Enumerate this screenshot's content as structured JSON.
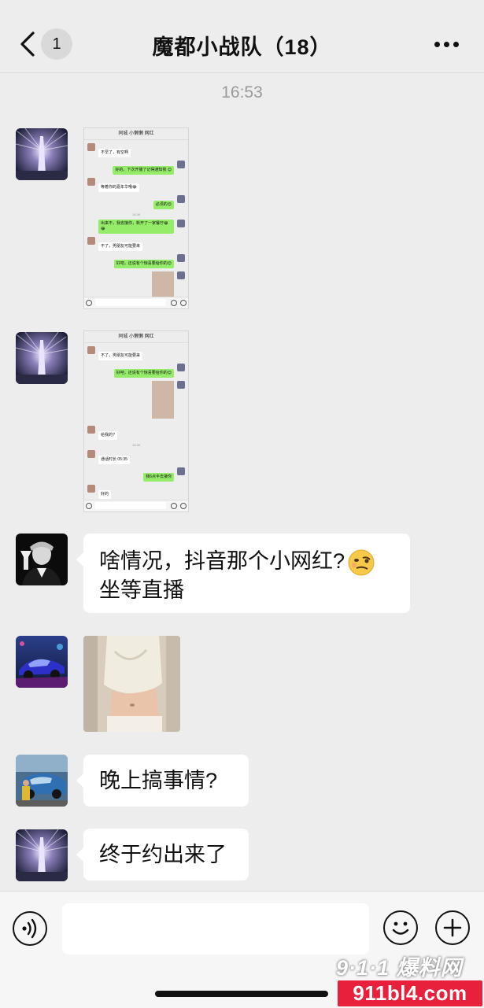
{
  "header": {
    "unread_count": "1",
    "title": "魔都小战队（18）",
    "back_icon": "chevron-left-icon",
    "more_icon": "more-dots-icon"
  },
  "chat": {
    "timestamp": "16:53",
    "screenshot1": {
      "title": "同城 小懒懒 网红",
      "messages": [
        {
          "side": "left",
          "text": "不早了，有空啊"
        },
        {
          "side": "right",
          "text": "好的，下次开播了记得通知我 😊"
        },
        {
          "side": "left",
          "text": "等着你的嘉年华哦😂"
        },
        {
          "side": "right",
          "text": "必须的😊"
        },
        {
          "side": "time",
          "text": "16:36"
        },
        {
          "side": "right",
          "text": "出来不，我去接你，新开了一家餐厅😂😂"
        },
        {
          "side": "left",
          "text": "不了，男朋友可能要来"
        },
        {
          "side": "right",
          "text": "好吧，还说有个惊喜要给你的😊"
        },
        {
          "side": "right-image",
          "text": ""
        }
      ]
    },
    "screenshot2": {
      "title": "同城 小懒懒 网红",
      "messages": [
        {
          "side": "left",
          "text": "不了，男朋友可能要来"
        },
        {
          "side": "right",
          "text": "好吧，还说有个惊喜要给你的😊"
        },
        {
          "side": "right-image",
          "text": ""
        },
        {
          "side": "left",
          "text": "给我的?"
        },
        {
          "side": "time",
          "text": "16:45"
        },
        {
          "side": "left",
          "text": "通话时长 05:35"
        },
        {
          "side": "right",
          "text": "我6点半去接你"
        },
        {
          "side": "left",
          "text": "好的"
        }
      ]
    },
    "message3": {
      "line1": "啥情况，抖音那个小网红?",
      "line2": "坐等直播",
      "emoji": "smirk-emoji-icon"
    },
    "message5": {
      "text": "晚上搞事情?"
    },
    "message6": {
      "text": "终于约出来了"
    }
  },
  "input_bar": {
    "text_value": "",
    "voice_icon": "voice-icon",
    "emoji_icon": "emoji-icon",
    "plus_icon": "plus-icon"
  },
  "watermark": {
    "top": "9·1·1 爆料网",
    "bottom": "911bl4.com"
  }
}
